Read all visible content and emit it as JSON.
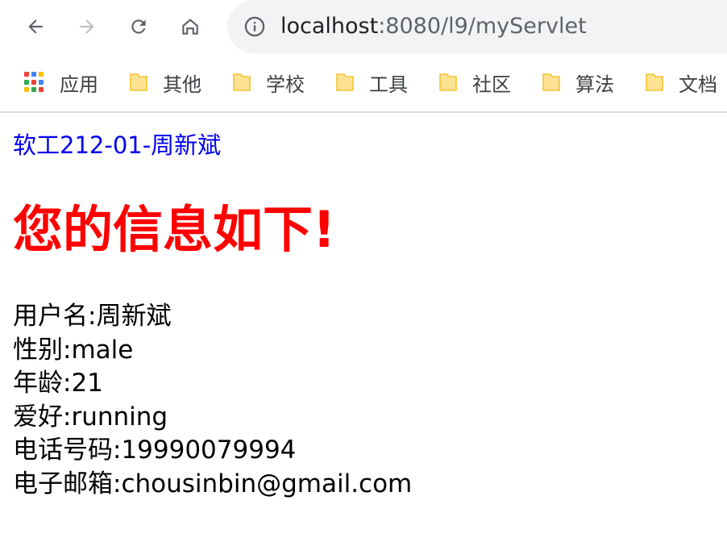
{
  "browser": {
    "url_host": "localhost",
    "url_rest": ":8080/l9/myServlet",
    "back_icon": "back-arrow-icon",
    "forward_icon": "forward-arrow-icon",
    "reload_icon": "reload-icon",
    "home_icon": "home-icon",
    "info_icon": "info-icon"
  },
  "bookmarks": {
    "apps_label": "应用",
    "items": [
      {
        "label": "其他"
      },
      {
        "label": "学校"
      },
      {
        "label": "工具"
      },
      {
        "label": "社区"
      },
      {
        "label": "算法"
      },
      {
        "label": "文档"
      }
    ]
  },
  "page": {
    "author": "软工212-01-周新斌",
    "heading": "您的信息如下!",
    "lines": {
      "username": "用户名:周新斌",
      "gender": "性别:male",
      "age": "年龄:21",
      "hobby": "爱好:running",
      "phone": "电话号码:19990079994",
      "email": "电子邮箱:chousinbin@gmail.com"
    }
  },
  "colors": {
    "author_link": "#0000ee",
    "heading": "#ff0000",
    "folder_fill": "#fde293",
    "folder_stroke": "#f4c430"
  }
}
